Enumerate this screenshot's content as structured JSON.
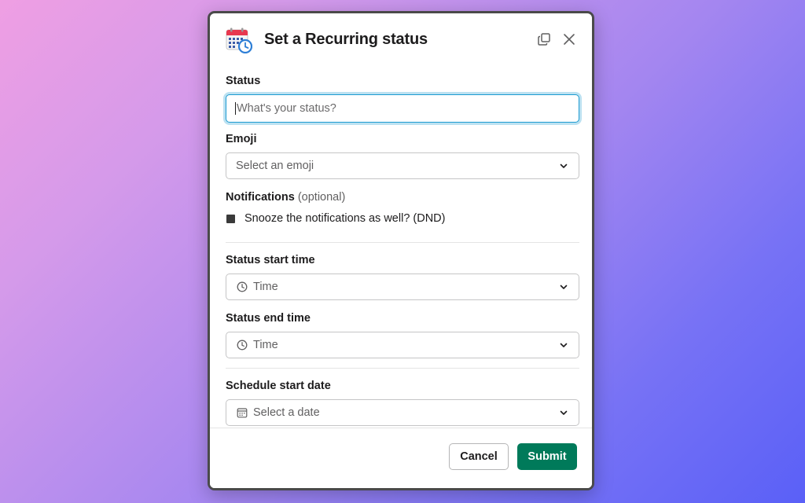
{
  "modal": {
    "title": "Set a Recurring status",
    "app_icon": "calendar-clock-icon"
  },
  "status": {
    "label": "Status",
    "placeholder": "What's your status?",
    "value": ""
  },
  "emoji": {
    "label": "Emoji",
    "placeholder": "Select an emoji"
  },
  "notifications": {
    "label": "Notifications",
    "optional": "(optional)",
    "checkbox_label": "Snooze the notifications as well? (DND)"
  },
  "start_time": {
    "label": "Status start time",
    "placeholder": "Time"
  },
  "end_time": {
    "label": "Status end time",
    "placeholder": "Time"
  },
  "schedule_date": {
    "label": "Schedule start date",
    "placeholder": "Select a date"
  },
  "footer": {
    "cancel_label": "Cancel",
    "submit_label": "Submit"
  },
  "colors": {
    "submit": "#007a5a",
    "focus": "#1d9bd1",
    "gradient_start": "#ef9fe3",
    "gradient_end": "#5a60f7"
  }
}
